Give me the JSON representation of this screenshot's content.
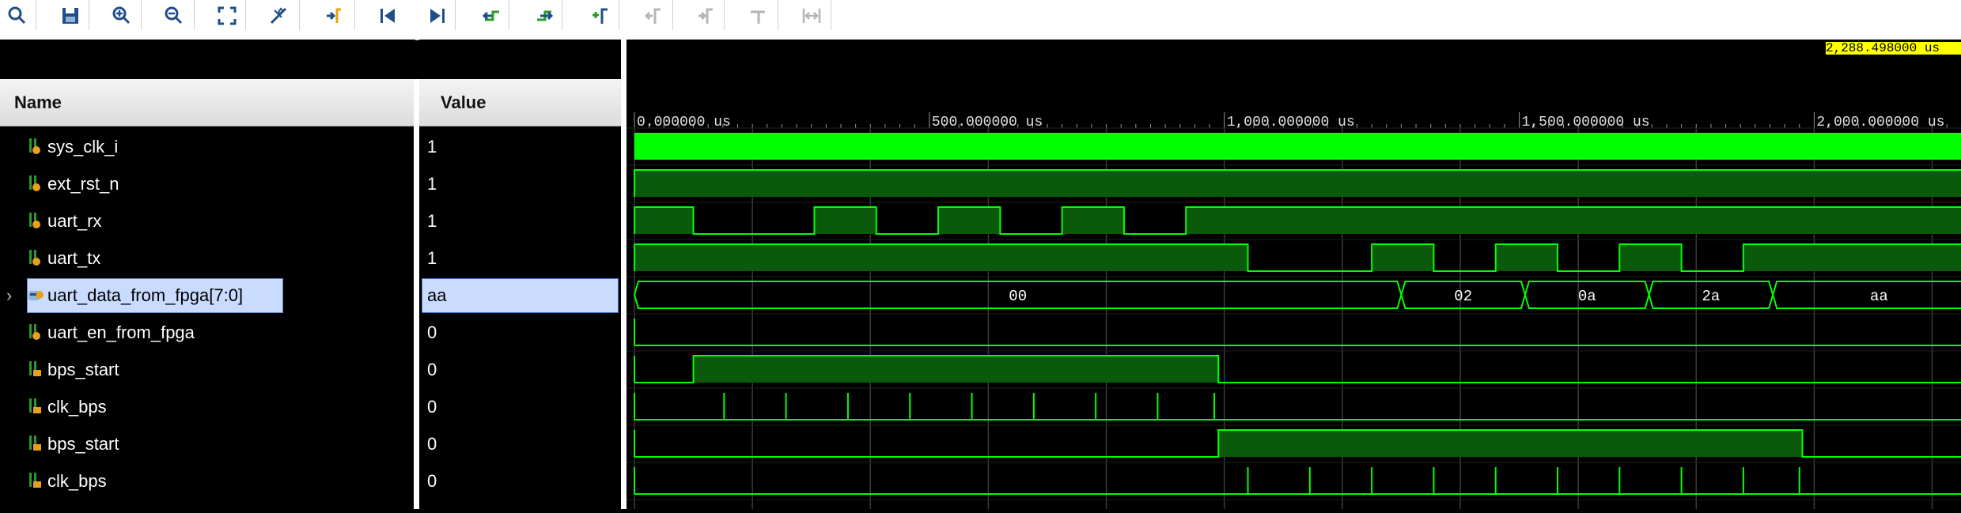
{
  "toolbar": {
    "buttons": [
      {
        "icon": "search-icon"
      },
      {
        "icon": "save-icon"
      },
      {
        "icon": "zoom-in-icon"
      },
      {
        "icon": "zoom-out-icon"
      },
      {
        "icon": "zoom-fit-icon"
      },
      {
        "icon": "cursor-snap-icon"
      },
      {
        "icon": "go-to-time-zero-icon"
      },
      {
        "icon": "go-to-start-icon"
      },
      {
        "icon": "go-to-end-icon"
      },
      {
        "icon": "previous-transition-icon"
      },
      {
        "icon": "next-transition-icon"
      },
      {
        "icon": "add-marker-icon"
      },
      {
        "icon": "previous-marker-icon"
      },
      {
        "icon": "next-marker-icon"
      },
      {
        "icon": "swap-cursors-icon"
      },
      {
        "icon": "fix-cursor-icon"
      }
    ]
  },
  "headers": {
    "name": "Name",
    "value": "Value"
  },
  "cursor": {
    "label": "2,288.498000 us",
    "time_us": 2288.498
  },
  "timeline": {
    "unit": "us",
    "ticks": [
      {
        "label": "0.000000 us",
        "t": 0
      },
      {
        "label": "500.000000 us",
        "t": 500
      },
      {
        "label": "1,000.000000 us",
        "t": 1000
      },
      {
        "label": "1,500.000000 us",
        "t": 1500
      },
      {
        "label": "2,000.000000 us",
        "t": 2000
      }
    ],
    "grid_us": [
      0,
      200,
      400,
      600,
      800,
      1000,
      1200,
      1400,
      1600,
      1800,
      2000,
      2200
    ]
  },
  "signals": [
    {
      "name": "sys_clk_i",
      "value": "1",
      "kind": "clock",
      "icon": "bit-signal-icon"
    },
    {
      "name": "ext_rst_n",
      "value": "1",
      "kind": "bit",
      "icon": "bit-signal-icon",
      "wave": [
        [
          0,
          1
        ]
      ]
    },
    {
      "name": "uart_rx",
      "value": "1",
      "kind": "bit",
      "icon": "bit-signal-icon",
      "wave": [
        [
          0,
          1
        ],
        [
          100,
          0
        ],
        [
          305,
          1
        ],
        [
          410,
          0
        ],
        [
          515,
          1
        ],
        [
          620,
          0
        ],
        [
          725,
          1
        ],
        [
          830,
          0
        ],
        [
          935,
          1
        ]
      ]
    },
    {
      "name": "uart_tx",
      "value": "1",
      "kind": "bit",
      "icon": "bit-signal-icon",
      "wave": [
        [
          0,
          1
        ],
        [
          1040,
          0
        ],
        [
          1250,
          1
        ],
        [
          1355,
          0
        ],
        [
          1460,
          1
        ],
        [
          1565,
          0
        ],
        [
          1670,
          1
        ],
        [
          1775,
          0
        ],
        [
          1880,
          1
        ]
      ]
    },
    {
      "name": "uart_data_from_fpga[7:0]",
      "value": "aa",
      "kind": "bus",
      "icon": "bus-signal-icon",
      "expandable": true,
      "selected": true,
      "segments": [
        {
          "t0": 0,
          "t1": 1300,
          "label": "00"
        },
        {
          "t0": 1300,
          "t1": 1510,
          "label": "02"
        },
        {
          "t0": 1510,
          "t1": 1720,
          "label": "0a"
        },
        {
          "t0": 1720,
          "t1": 1930,
          "label": "2a"
        },
        {
          "t0": 1930,
          "t1": 2290,
          "label": "aa"
        }
      ]
    },
    {
      "name": "uart_en_from_fpga",
      "value": "0",
      "kind": "bit",
      "icon": "bit-signal-icon",
      "wave": [
        [
          0,
          0
        ]
      ]
    },
    {
      "name": "bps_start",
      "value": "0",
      "kind": "bit",
      "icon": "internal-signal-icon",
      "wave": [
        [
          0,
          0
        ],
        [
          100,
          1
        ],
        [
          990,
          0
        ]
      ]
    },
    {
      "name": "clk_bps",
      "value": "0",
      "kind": "pulses",
      "icon": "internal-signal-icon",
      "pulses": [
        152,
        257,
        362,
        467,
        572,
        677,
        782,
        887,
        983
      ]
    },
    {
      "name": "bps_start",
      "value": "0",
      "kind": "bit",
      "icon": "internal-signal-icon",
      "wave": [
        [
          0,
          0
        ],
        [
          990,
          1
        ],
        [
          1980,
          0
        ]
      ]
    },
    {
      "name": "clk_bps",
      "value": "0",
      "kind": "pulses",
      "icon": "internal-signal-icon",
      "pulses": [
        1040,
        1145,
        1250,
        1355,
        1460,
        1565,
        1670,
        1775,
        1880,
        1975
      ]
    }
  ],
  "colors": {
    "wave": "#00ff00",
    "wave_fill": "#0b5a0b",
    "grid": "#3c3c3c",
    "cursor_label_bg": "#ffff00",
    "selection_bg": "#c9dcff"
  }
}
